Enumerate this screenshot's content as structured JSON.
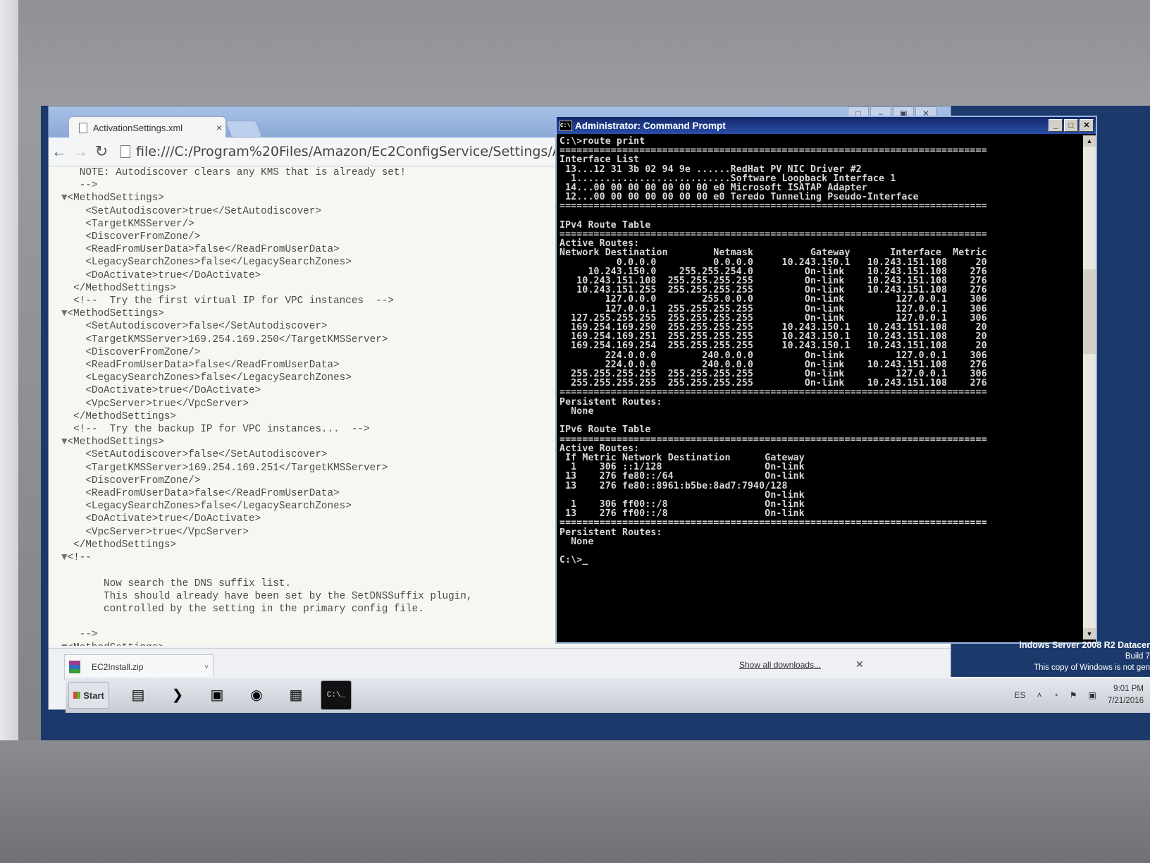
{
  "browser": {
    "tab_title": "ActivationSettings.xml",
    "tab_close": "×",
    "url": "file:///C:/Program%20Files/Amazon/Ec2ConfigService/Settings/Activa",
    "window_buttons": [
      "□",
      "–",
      "▣",
      "✕"
    ],
    "back": "←",
    "forward": "→",
    "reload": "↻",
    "xml_lines": [
      {
        "text": "   NOTE: Autodiscover clears any KMS that is already set!"
      },
      {
        "text": "   -->"
      },
      {
        "text": "<MethodSettings>",
        "tri": "▼"
      },
      {
        "text": "    <SetAutodiscover>true</SetAutodiscover>"
      },
      {
        "text": "    <TargetKMSServer/>"
      },
      {
        "text": "    <DiscoverFromZone/>"
      },
      {
        "text": "    <ReadFromUserData>false</ReadFromUserData>"
      },
      {
        "text": "    <LegacySearchZones>false</LegacySearchZones>"
      },
      {
        "text": "    <DoActivate>true</DoActivate>"
      },
      {
        "text": "  </MethodSettings>"
      },
      {
        "text": "  <!--  Try the first virtual IP for VPC instances  -->"
      },
      {
        "text": "<MethodSettings>",
        "tri": "▼"
      },
      {
        "text": "    <SetAutodiscover>false</SetAutodiscover>"
      },
      {
        "text": "    <TargetKMSServer>169.254.169.250</TargetKMSServer>"
      },
      {
        "text": "    <DiscoverFromZone/>"
      },
      {
        "text": "    <ReadFromUserData>false</ReadFromUserData>"
      },
      {
        "text": "    <LegacySearchZones>false</LegacySearchZones>"
      },
      {
        "text": "    <DoActivate>true</DoActivate>"
      },
      {
        "text": "    <VpcServer>true</VpcServer>"
      },
      {
        "text": "  </MethodSettings>"
      },
      {
        "text": "  <!--  Try the backup IP for VPC instances...  -->"
      },
      {
        "text": "<MethodSettings>",
        "tri": "▼"
      },
      {
        "text": "    <SetAutodiscover>false</SetAutodiscover>"
      },
      {
        "text": "    <TargetKMSServer>169.254.169.251</TargetKMSServer>"
      },
      {
        "text": "    <DiscoverFromZone/>"
      },
      {
        "text": "    <ReadFromUserData>false</ReadFromUserData>"
      },
      {
        "text": "    <LegacySearchZones>false</LegacySearchZones>"
      },
      {
        "text": "    <DoActivate>true</DoActivate>"
      },
      {
        "text": "    <VpcServer>true</VpcServer>"
      },
      {
        "text": "  </MethodSettings>"
      },
      {
        "text": "<!--",
        "tri": "▼"
      },
      {
        "text": ""
      },
      {
        "text": "       Now search the DNS suffix list."
      },
      {
        "text": "       This should already have been set by the SetDNSSuffix plugin,"
      },
      {
        "text": "       controlled by the setting in the primary config file."
      },
      {
        "text": ""
      },
      {
        "text": "   -->"
      },
      {
        "text": "<MethodSettings>",
        "tri": "▼"
      }
    ],
    "download": {
      "file": "EC2Install.zip",
      "chevron": "˅",
      "show_all": "Show all downloads...",
      "close": "✕"
    }
  },
  "cmd": {
    "title": "Administrator: Command Prompt",
    "icon_text": "C:\\",
    "buttons": [
      "_",
      "□",
      "✕"
    ],
    "lines": [
      "C:\\>route print",
      "===========================================================================",
      "Interface List",
      " 13...12 31 3b 02 94 9e ......RedHat PV NIC Driver #2",
      "  1...........................Software Loopback Interface 1",
      " 14...00 00 00 00 00 00 00 e0 Microsoft ISATAP Adapter",
      " 12...00 00 00 00 00 00 00 e0 Teredo Tunneling Pseudo-Interface",
      "===========================================================================",
      "",
      "IPv4 Route Table",
      "===========================================================================",
      "Active Routes:",
      "Network Destination        Netmask          Gateway       Interface  Metric",
      "          0.0.0.0          0.0.0.0     10.243.150.1   10.243.151.108     20",
      "     10.243.150.0    255.255.254.0         On-link    10.243.151.108    276",
      "   10.243.151.108  255.255.255.255         On-link    10.243.151.108    276",
      "   10.243.151.255  255.255.255.255         On-link    10.243.151.108    276",
      "        127.0.0.0        255.0.0.0         On-link         127.0.0.1    306",
      "        127.0.0.1  255.255.255.255         On-link         127.0.0.1    306",
      "  127.255.255.255  255.255.255.255         On-link         127.0.0.1    306",
      "  169.254.169.250  255.255.255.255     10.243.150.1   10.243.151.108     20",
      "  169.254.169.251  255.255.255.255     10.243.150.1   10.243.151.108     20",
      "  169.254.169.254  255.255.255.255     10.243.150.1   10.243.151.108     20",
      "        224.0.0.0        240.0.0.0         On-link         127.0.0.1    306",
      "        224.0.0.0        240.0.0.0         On-link    10.243.151.108    276",
      "  255.255.255.255  255.255.255.255         On-link         127.0.0.1    306",
      "  255.255.255.255  255.255.255.255         On-link    10.243.151.108    276",
      "===========================================================================",
      "Persistent Routes:",
      "  None",
      "",
      "IPv6 Route Table",
      "===========================================================================",
      "Active Routes:",
      " If Metric Network Destination      Gateway",
      "  1    306 ::1/128                  On-link",
      " 13    276 fe80::/64                On-link",
      " 13    276 fe80::8961:b5be:8ad7:7940/128",
      "                                    On-link",
      "  1    306 ff00::/8                 On-link",
      " 13    276 ff00::/8                 On-link",
      "===========================================================================",
      "Persistent Routes:",
      "  None",
      "",
      "C:\\>_"
    ]
  },
  "watermark": {
    "line1": "indows Server 2008 R2 Datacer",
    "line2": "Build 7",
    "line3": "This copy of Windows is not gen"
  },
  "taskbar": {
    "start_label": "Start",
    "apps": [
      {
        "name": "server-manager-icon",
        "glyph": "▤"
      },
      {
        "name": "powershell-icon",
        "glyph": "❯"
      },
      {
        "name": "explorer-icon",
        "glyph": "▣"
      },
      {
        "name": "chrome-icon",
        "glyph": "◉"
      },
      {
        "name": "network-icon",
        "glyph": "▦"
      },
      {
        "name": "cmd-icon",
        "glyph": "C:\\_"
      }
    ],
    "language": "ES",
    "time": "9:01 PM",
    "date": "7/21/2016"
  }
}
